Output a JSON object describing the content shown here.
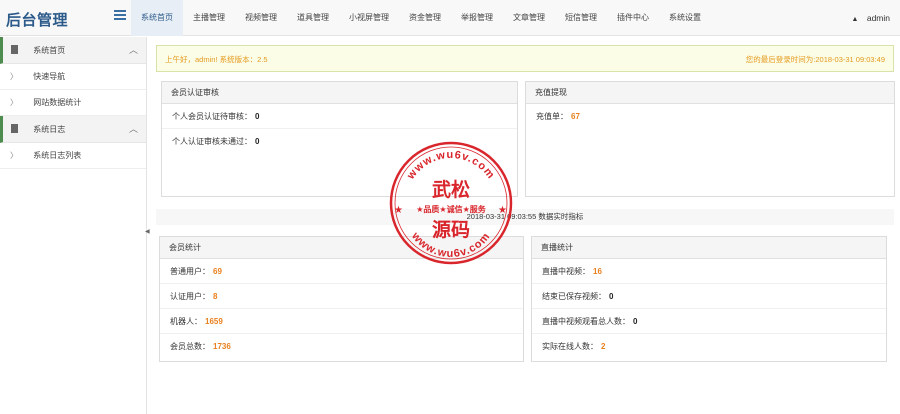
{
  "header": {
    "brand": "后台管理",
    "nav": [
      {
        "label": "系统首页",
        "active": true
      },
      {
        "label": "主播管理"
      },
      {
        "label": "视频管理"
      },
      {
        "label": "道具管理"
      },
      {
        "label": "小视屏管理"
      },
      {
        "label": "资金管理"
      },
      {
        "label": "举报管理"
      },
      {
        "label": "文章管理"
      },
      {
        "label": "短信管理"
      },
      {
        "label": "插件中心"
      },
      {
        "label": "系统设置"
      }
    ],
    "user": "admin",
    "user_caret": "▲"
  },
  "sidebar": {
    "groups": [
      {
        "label": "系统首页",
        "chevron": "︿",
        "items": [
          "快速导航",
          "网站数据统计"
        ]
      },
      {
        "label": "系统日志",
        "chevron": "︿",
        "items": [
          "系统日志列表"
        ]
      }
    ],
    "item_chevron": "〉",
    "collapse_glyph": "◀"
  },
  "alert": {
    "greeting": "上午好，admin! 系统版本：2.5",
    "last_login": "您的最后登录时间为:2018-03-31 09:03:49"
  },
  "panels": {
    "member_auth": {
      "title": "会员认证审核",
      "rows": [
        {
          "label": "个人会员认证待审核：",
          "value": "0"
        },
        {
          "label": "个人认证审核未通过：",
          "value": "0"
        }
      ]
    },
    "recharge": {
      "title": "充值提现",
      "rows": [
        {
          "label": "充值单：",
          "value": "67"
        }
      ]
    },
    "member_stats": {
      "title": "会员统计",
      "rows": [
        {
          "label": "普通用户：",
          "value": "69"
        },
        {
          "label": "认证用户：",
          "value": "8"
        },
        {
          "label": "机器人：",
          "value": "1659"
        },
        {
          "label": "会员总数：",
          "value": "1736"
        }
      ]
    },
    "live_stats": {
      "title": "直播统计",
      "rows": [
        {
          "label": "直播中视频：",
          "value": "16"
        },
        {
          "label": "结束已保存视频：",
          "value": "0"
        },
        {
          "label": "直播中视频观看总人数：",
          "value": "0"
        },
        {
          "label": "实际在线人数：",
          "value": "2"
        }
      ]
    }
  },
  "realtime": "2018-03-31 09:03:55 数据实时指标",
  "watermark": {
    "url_top": "www.wu6v.com",
    "url_bottom": "www.wu6v.com",
    "title_line1": "武松",
    "title_line2": "源码",
    "slogan": "★品质★诚信★服务"
  },
  "colors": {
    "brand": "#2c5a8a",
    "accent_value": "#e8801f",
    "alert_text": "#e59a1f",
    "stamp_red": "#d9262c"
  }
}
